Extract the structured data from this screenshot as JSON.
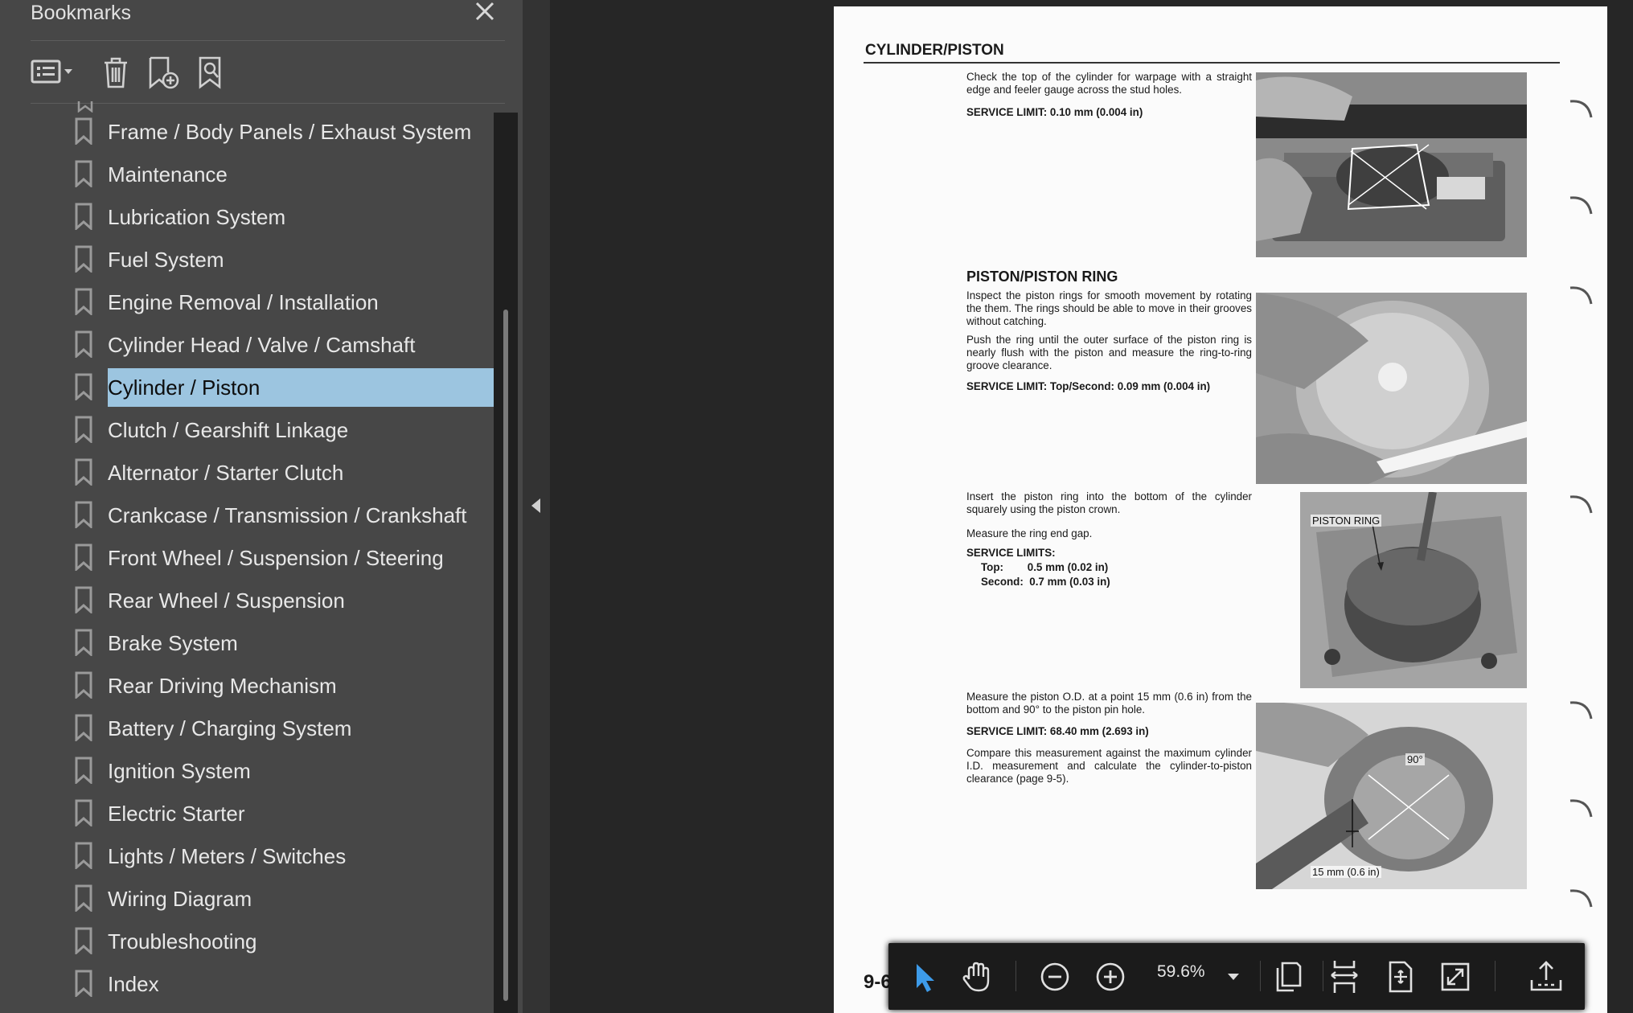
{
  "sidebar": {
    "title": "Bookmarks",
    "tools": [
      "options-menu-icon",
      "delete-bookmark-icon",
      "add-bookmark-icon",
      "find-bookmark-icon"
    ],
    "items": [
      {
        "label": "Frame / Body Panels / Exhaust System"
      },
      {
        "label": "Maintenance"
      },
      {
        "label": "Lubrication System"
      },
      {
        "label": "Fuel System"
      },
      {
        "label": "Engine Removal / Installation"
      },
      {
        "label": "Cylinder Head / Valve / Camshaft"
      },
      {
        "label": "Cylinder / Piston",
        "selected": true
      },
      {
        "label": "Clutch / Gearshift Linkage"
      },
      {
        "label": "Alternator / Starter Clutch"
      },
      {
        "label": "Crankcase / Transmission / Crankshaft"
      },
      {
        "label": "Front Wheel / Suspension / Steering"
      },
      {
        "label": "Rear Wheel / Suspension"
      },
      {
        "label": "Brake System"
      },
      {
        "label": "Rear Driving Mechanism"
      },
      {
        "label": "Battery / Charging System"
      },
      {
        "label": "Ignition System"
      },
      {
        "label": "Electric Starter"
      },
      {
        "label": "Lights / Meters / Switches"
      },
      {
        "label": "Wiring Diagram"
      },
      {
        "label": "Troubleshooting"
      },
      {
        "label": "Index"
      }
    ]
  },
  "document": {
    "section_title": "CYLINDER/PISTON",
    "warpage_text": "Check the top of the cylinder for warpage with a straight edge and feeler gauge across the stud holes.",
    "warpage_limit": "SERVICE LIMIT: 0.10 mm (0.004 in)",
    "piston_ring_heading": "PISTON/PISTON RING",
    "ring_inspect_text": "Inspect the piston rings for smooth movement by rotating the them. The rings should be able to move in their grooves without catching.",
    "ring_push_text": "Push the ring until the outer surface of the piston ring is nearly flush with the piston and measure the ring-to-ring groove clearance.",
    "ring_limit": "SERVICE LIMIT: Top/Second: 0.09 mm (0.004 in)",
    "ring_insert_text": "Insert the piston ring into the bottom of the cylinder squarely using the piston crown.",
    "ring_gap_text": "Measure the ring end gap.",
    "limits_heading": "SERVICE LIMITS:",
    "limit_top": "Top:        0.5 mm (0.02 in)",
    "limit_second": "Second:  0.7 mm (0.03 in)",
    "piston_ring_callout": "PISTON RING",
    "piston_od_text": "Measure the piston O.D. at a point 15 mm (0.6 in) from the bottom and 90° to the piston pin hole.",
    "piston_od_limit": "SERVICE LIMIT: 68.40 mm (2.693 in)",
    "compare_text": "Compare this measurement against the maximum cylinder I.D. measurement and calculate the cylinder-to-piston clearance (page 9-5).",
    "angle_callout": "90°",
    "distance_callout": "15 mm (0.6 in)",
    "page_number": "9-6"
  },
  "toolbar": {
    "zoom": "59.6%",
    "tools": [
      "select-cursor-icon",
      "hand-tool-icon",
      "zoom-out-icon",
      "zoom-in-icon",
      "page-display-icon",
      "fit-width-icon",
      "fit-page-icon",
      "full-screen-icon",
      "share-upload-icon"
    ]
  },
  "colors": {
    "sidebar_bg": "#474747",
    "selected_bg": "#9cc5e0",
    "viewer_bg": "#262626",
    "toolbar_bg": "#1b1b1b",
    "select_tool_accent": "#3d9be9"
  }
}
